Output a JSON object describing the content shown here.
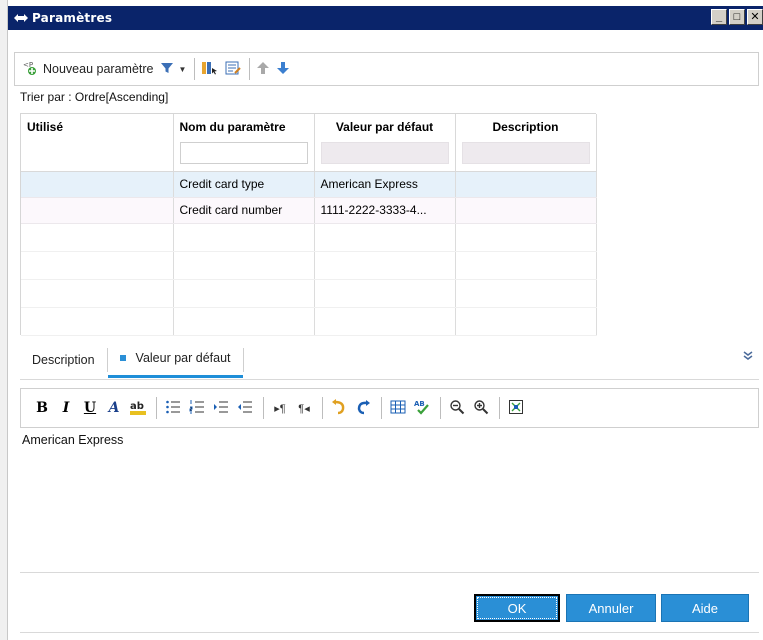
{
  "window": {
    "title": "Paramètres"
  },
  "toolbar": {
    "new_param_label": "Nouveau paramètre"
  },
  "sort": {
    "text": "Trier par : Ordre[Ascending]"
  },
  "grid": {
    "columns": [
      "Utilisé",
      "Nom du paramètre",
      "Valeur par défaut",
      "Description"
    ],
    "rows": [
      {
        "used": "",
        "name": "Credit card type",
        "default": "American Express",
        "description": ""
      },
      {
        "used": "",
        "name": "Credit card number",
        "default": "1111-2222-3333-4...",
        "description": ""
      }
    ]
  },
  "tabs": {
    "description": "Description",
    "default_value": "Valeur par défaut"
  },
  "editor": {
    "content": "American Express"
  },
  "buttons": {
    "ok": "OK",
    "cancel": "Annuler",
    "help": "Aide"
  },
  "colors": {
    "accent": "#2a8fd6",
    "title_bar": "#0a246a",
    "selected_row": "#e6f1fa"
  }
}
